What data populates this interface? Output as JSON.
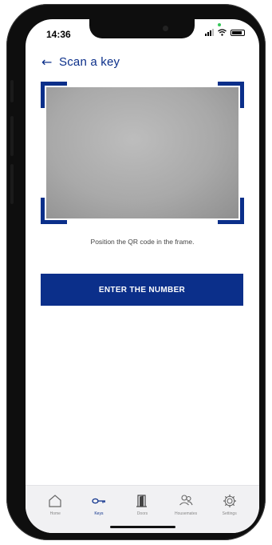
{
  "status": {
    "time": "14:36"
  },
  "header": {
    "title": "Scan a key",
    "back_icon": "arrow-left-icon"
  },
  "scanner": {
    "hint": "Position the QR code in the frame."
  },
  "actions": {
    "enter_number_label": "ENTER THE NUMBER"
  },
  "tabs": [
    {
      "label": "Home",
      "icon": "home-icon",
      "active": false
    },
    {
      "label": "Keys",
      "icon": "key-icon",
      "active": true
    },
    {
      "label": "Doors",
      "icon": "door-icon",
      "active": false
    },
    {
      "label": "Housemates",
      "icon": "people-icon",
      "active": false
    },
    {
      "label": "Settings",
      "icon": "gear-icon",
      "active": false
    }
  ],
  "colors": {
    "accent": "#0b2f8a",
    "camera_gray": "#a9a9a9"
  }
}
